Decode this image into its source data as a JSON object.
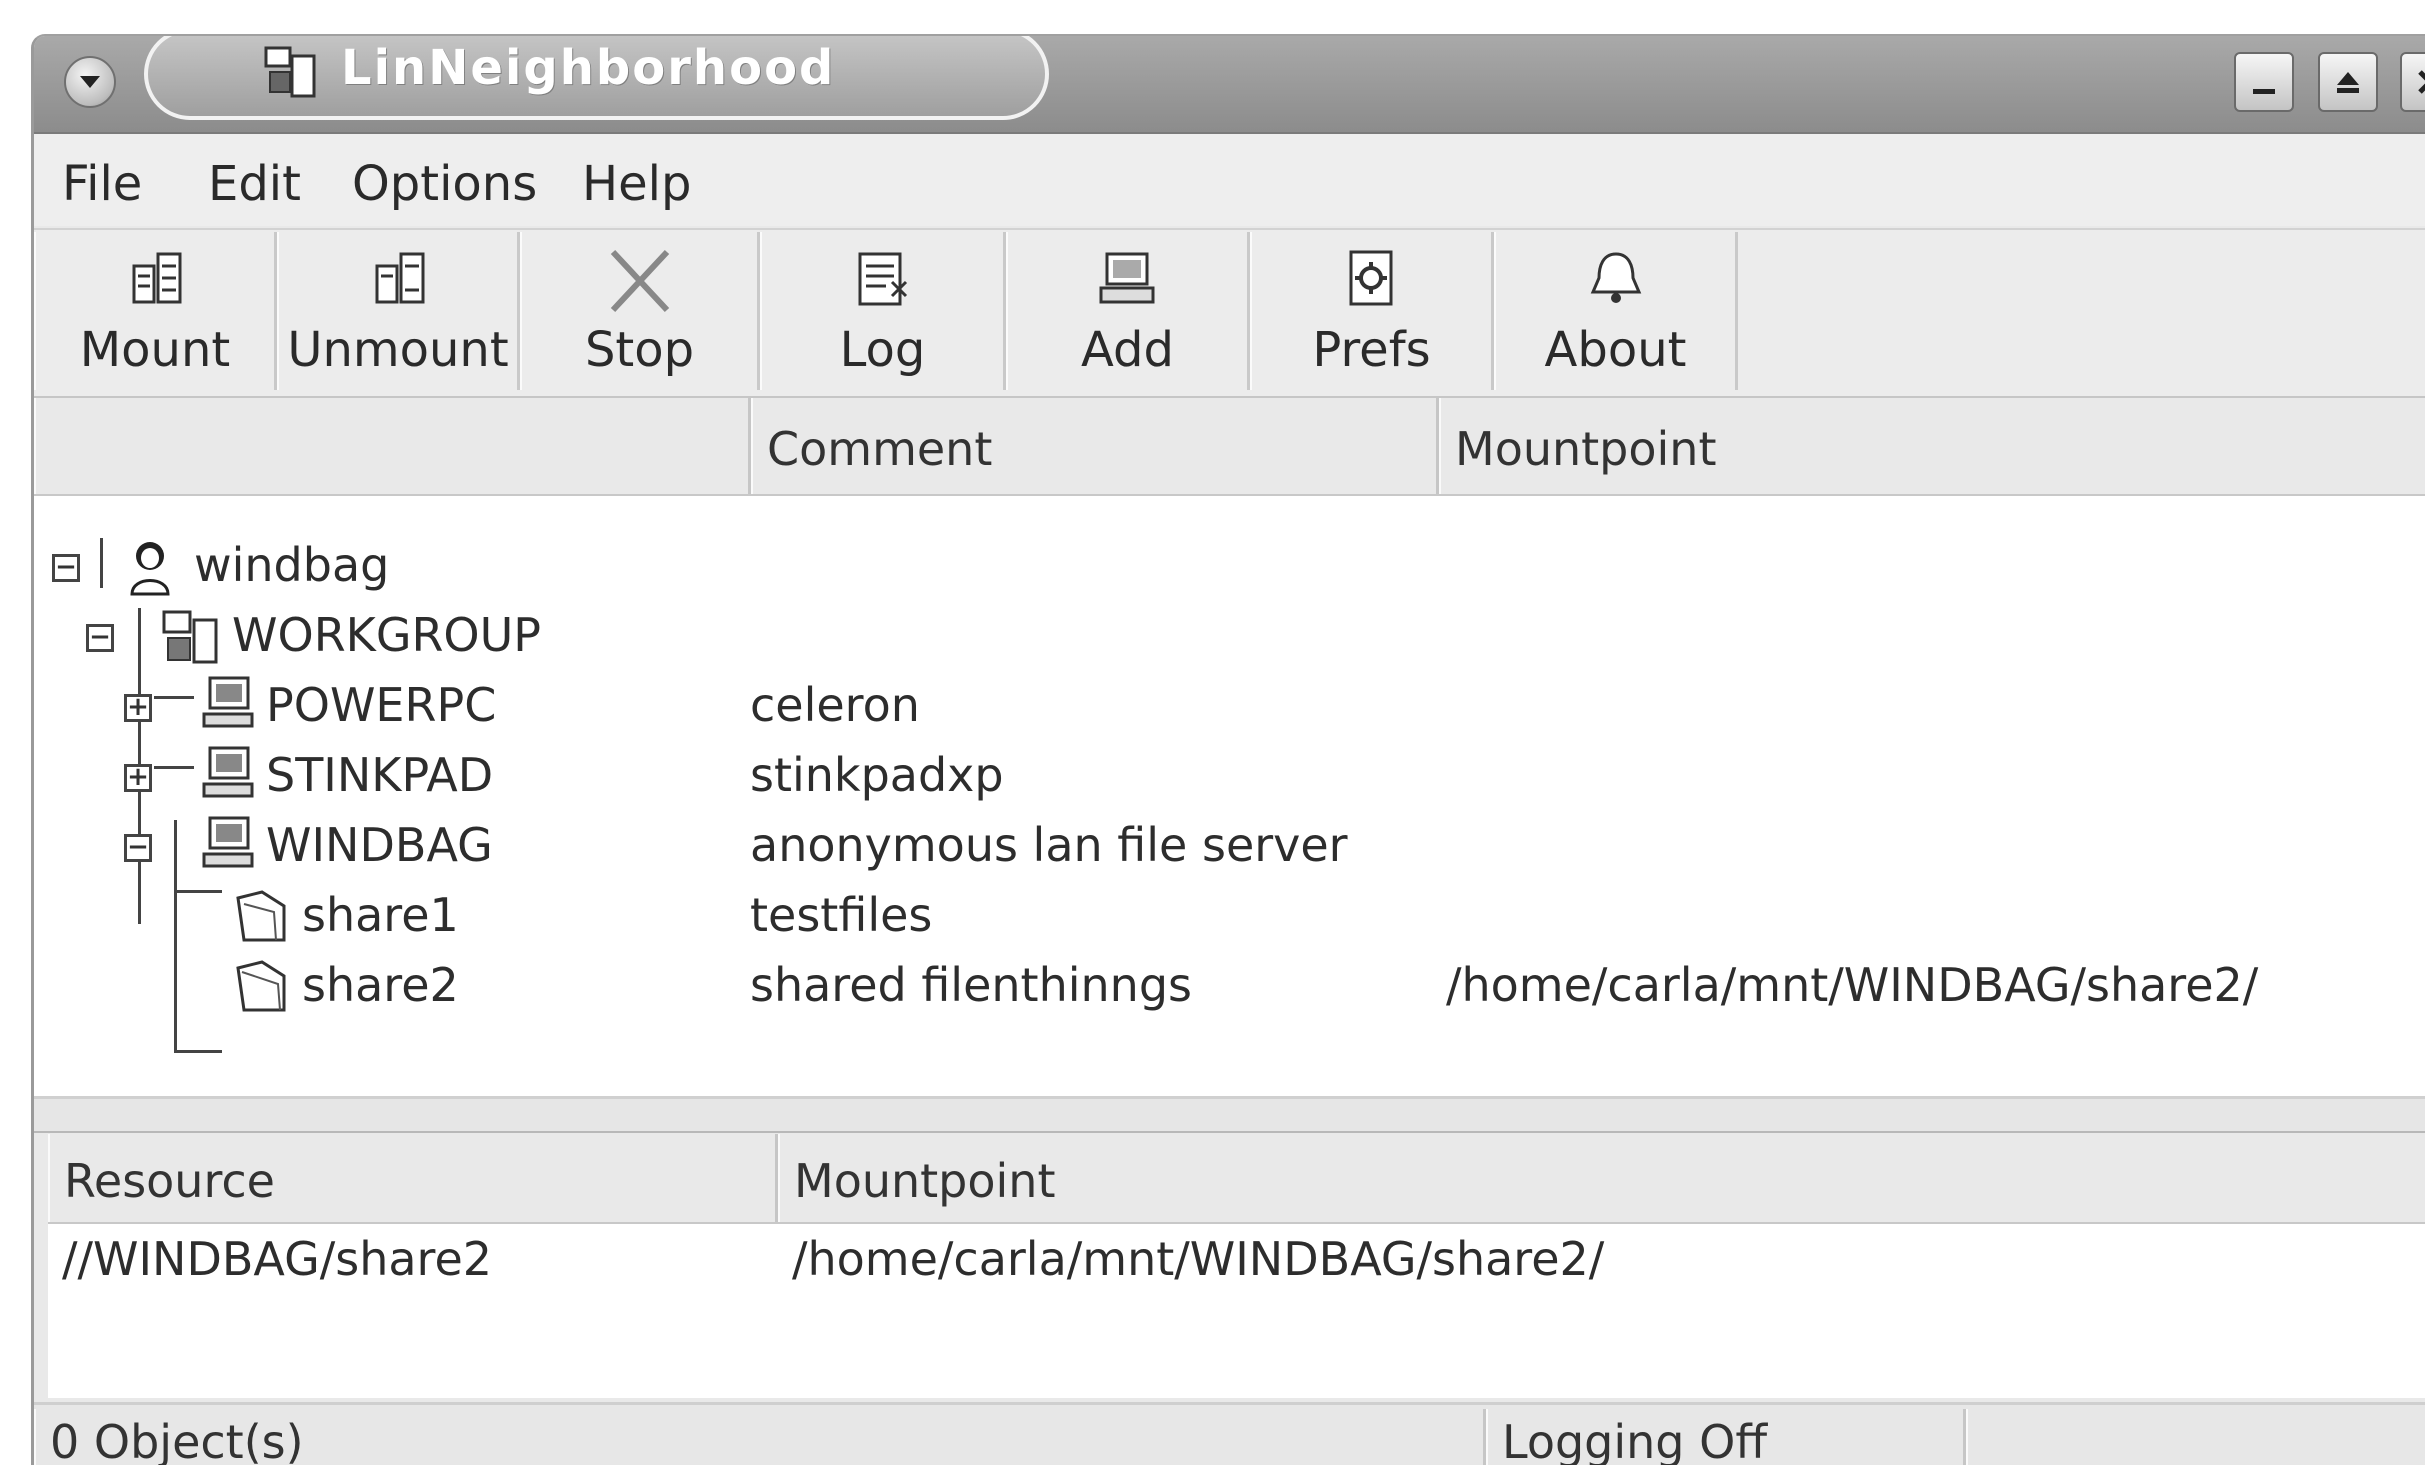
{
  "window": {
    "title": "LinNeighborhood"
  },
  "menubar": {
    "items": [
      "File",
      "Edit",
      "Options",
      "Help"
    ]
  },
  "toolbar": {
    "buttons": [
      {
        "label": "Mount",
        "icon": "mount-icon"
      },
      {
        "label": "Unmount",
        "icon": "unmount-icon"
      },
      {
        "label": "Stop",
        "icon": "stop-icon"
      },
      {
        "label": "Log",
        "icon": "log-icon"
      },
      {
        "label": "Add",
        "icon": "add-icon"
      },
      {
        "label": "Prefs",
        "icon": "prefs-icon"
      },
      {
        "label": "About",
        "icon": "about-icon"
      }
    ]
  },
  "tree": {
    "columns": [
      "",
      "Comment",
      "Mountpoint"
    ],
    "rows": [
      {
        "name": "windbag",
        "comment": "",
        "mountpoint": "",
        "icon": "user-icon",
        "expander": "minus"
      },
      {
        "name": "WORKGROUP",
        "comment": "",
        "mountpoint": "",
        "icon": "workgroup-icon",
        "expander": "minus"
      },
      {
        "name": "POWERPC",
        "comment": "celeron",
        "mountpoint": "",
        "icon": "computer-icon",
        "expander": "plus"
      },
      {
        "name": "STINKPAD",
        "comment": "stinkpadxp",
        "mountpoint": "",
        "icon": "computer-icon",
        "expander": "plus"
      },
      {
        "name": "WINDBAG",
        "comment": "anonymous lan file server",
        "mountpoint": "",
        "icon": "computer-icon",
        "expander": "minus"
      },
      {
        "name": "share1",
        "comment": "testfiles",
        "mountpoint": "",
        "icon": "folder-icon",
        "expander": "none"
      },
      {
        "name": "share2",
        "comment": "shared filenthinngs",
        "mountpoint": "/home/carla/mnt/WINDBAG/share2/",
        "icon": "folder-icon",
        "expander": "none"
      }
    ]
  },
  "mounts": {
    "columns": [
      "Resource",
      "Mountpoint"
    ],
    "rows": [
      {
        "resource": "//WINDBAG/share2",
        "mountpoint": "/home/carla/mnt/WINDBAG/share2/"
      }
    ]
  },
  "status": {
    "objects": "0 Object(s)",
    "logging": "Logging Off"
  }
}
